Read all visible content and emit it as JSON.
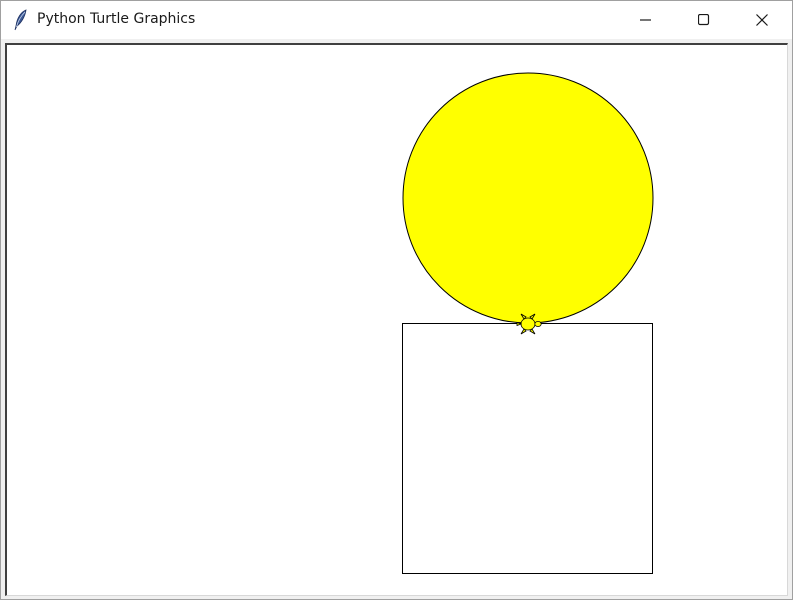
{
  "window": {
    "title": "Python Turtle Graphics",
    "app_icon": "feather-icon",
    "controls": {
      "minimize_icon": "minimize-icon",
      "maximize_icon": "maximize-icon",
      "close_icon": "close-icon"
    }
  },
  "canvas": {
    "background": "#ffffff",
    "circle": {
      "fill": "#ffff00",
      "stroke": "#000000"
    },
    "square": {
      "fill": "#ffffff",
      "stroke": "#000000"
    },
    "turtle": {
      "shape": "turtle",
      "fill": "#ffff00",
      "stroke": "#000000"
    }
  }
}
